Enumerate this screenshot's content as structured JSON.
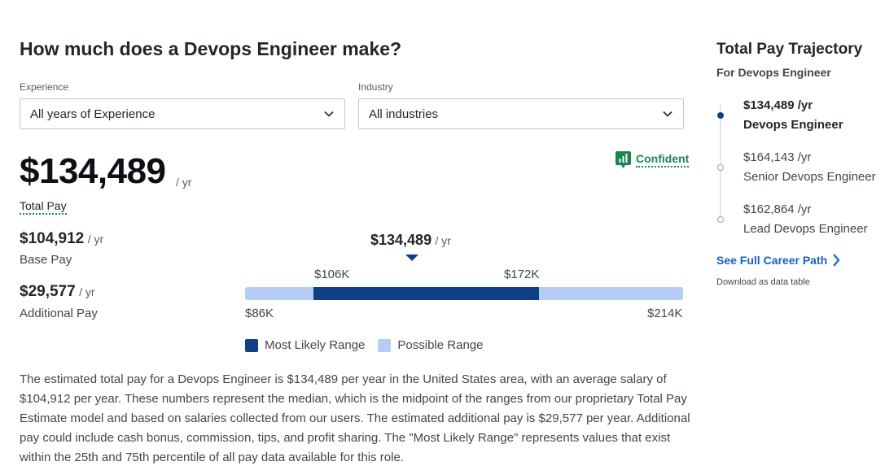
{
  "heading": "How much does a Devops Engineer make?",
  "filters": {
    "experience_label": "Experience",
    "experience_value": "All years of Experience",
    "industry_label": "Industry",
    "industry_value": "All industries"
  },
  "confidence": {
    "label": "Confident",
    "icon": "signal-bars-icon",
    "color": "#1a8751"
  },
  "total_pay": {
    "amount": "$134,489",
    "unit": "/ yr",
    "label": "Total Pay"
  },
  "base_pay": {
    "amount": "$104,912",
    "unit": "/ yr",
    "label": "Base Pay"
  },
  "additional_pay": {
    "amount": "$29,577",
    "unit": "/ yr",
    "label": "Additional Pay"
  },
  "range": {
    "marker_amount": "$134,489",
    "marker_unit": "/ yr",
    "likely_low": "$106K",
    "likely_high": "$172K",
    "min": "$86K",
    "max": "$214K",
    "values": {
      "min": 86,
      "likely_low": 106,
      "likely_high": 172,
      "max": 214,
      "marker": 134.489
    },
    "colors": {
      "likely": "#0f3f85",
      "possible": "#b5cdf5"
    }
  },
  "legend": {
    "likely": "Most Likely Range",
    "possible": "Possible Range"
  },
  "description": "The estimated total pay for a Devops Engineer is $134,489 per year in the United States area, with an average salary of $104,912 per year. These numbers represent the median, which is the midpoint of the ranges from our proprietary Total Pay Estimate model and based on salaries collected from our users. The estimated additional pay is $29,577 per year. Additional pay could include cash bonus, commission, tips, and profit sharing. The \"Most Likely Range\" represents values that exist within the 25th and 75th percentile of all pay data available for this role.",
  "trajectory": {
    "title": "Total Pay Trajectory",
    "subtitle": "For Devops Engineer",
    "items": [
      {
        "salary": "$134,489 /yr",
        "role": "Devops Engineer"
      },
      {
        "salary": "$164,143 /yr",
        "role": "Senior Devops Engineer"
      },
      {
        "salary": "$162,864 /yr",
        "role": "Lead Devops Engineer"
      }
    ],
    "link": "See Full Career Path",
    "download": "Download as data table"
  }
}
